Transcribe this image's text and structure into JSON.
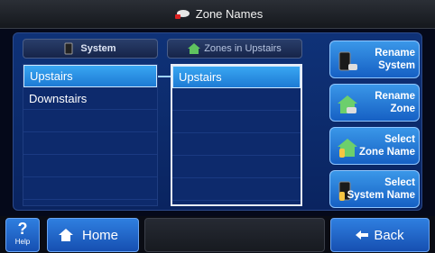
{
  "header": {
    "title": "Zone Names",
    "icon": "sensor-icon"
  },
  "columns": {
    "system_header": "System",
    "zones_header": "Zones in Upstairs"
  },
  "system_list": [
    "Upstairs",
    "Downstairs"
  ],
  "system_selected_index": 0,
  "zone_list": [
    "Upstairs"
  ],
  "zone_selected_index": 0,
  "actions": {
    "rename_system": [
      "Rename",
      "System"
    ],
    "rename_zone": [
      "Rename",
      "Zone"
    ],
    "select_zone_name": [
      "Select",
      "Zone Name"
    ],
    "select_system_name": [
      "Select",
      "System Name"
    ]
  },
  "footer": {
    "help_symbol": "?",
    "help_label": "Help",
    "home_label": "Home",
    "back_label": "Back"
  },
  "colors": {
    "selection": "#2b8fe6",
    "panel": "#0f3278",
    "button": "#2678d8"
  }
}
